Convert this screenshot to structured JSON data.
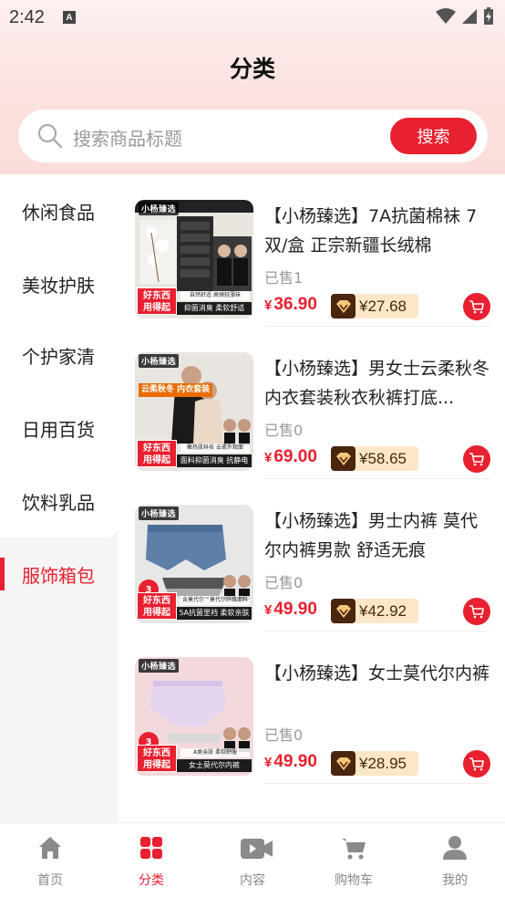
{
  "status_bar": {
    "time": "2:42"
  },
  "header": {
    "title": "分类"
  },
  "search": {
    "placeholder": "搜索商品标题",
    "button_label": "搜索"
  },
  "sidebar": {
    "items": [
      {
        "label": "休闲食品",
        "active": false
      },
      {
        "label": "美妆护肤",
        "active": false
      },
      {
        "label": "个护家清",
        "active": false
      },
      {
        "label": "日用百货",
        "active": false
      },
      {
        "label": "饮料乳品",
        "active": false
      },
      {
        "label": "服饰箱包",
        "active": true
      }
    ]
  },
  "products": [
    {
      "title": "【小杨臻选】7A抗菌棉袜 7双/盒 正宗新疆长绒棉",
      "sold": "已售1",
      "price_symbol": "¥",
      "price": "36.90",
      "vip_price": "¥27.68",
      "image": {
        "logo": "小杨臻选",
        "promo": "好东西 用得起",
        "tag": "抑菌消臭 柔软舒适",
        "subtag": "自然舒适 高弹轻薄袜"
      }
    },
    {
      "title": "【小杨臻选】男女士云柔秋冬内衣套装秋衣秋裤打底...",
      "sold": "已售0",
      "price_symbol": "¥",
      "price": "69.00",
      "vip_price": "¥58.65",
      "image": {
        "logo": "小杨臻选",
        "promo": "好东西 用得起",
        "tag": "面料抑菌消臭 抗静电",
        "subtag": "聚热肌科技 云柔外观面",
        "side": "云柔秋冬 内衣套装"
      }
    },
    {
      "title": "【小杨臻选】男士内裤 莫代尔内裤男款 舒适无痕",
      "sold": "已售0",
      "price_symbol": "¥",
      "price": "49.90",
      "vip_price": "¥42.92",
      "image": {
        "logo": "小杨臻选",
        "promo": "好东西 用得起",
        "tag": "5A抗菌里裆 柔软亲肤",
        "subtag": "含莫代尔™莫代尔纤维面料",
        "pack": "3"
      }
    },
    {
      "title": "【小杨臻选】女士莫代尔内裤",
      "sold": "已售0",
      "price_symbol": "¥",
      "price": "49.90",
      "vip_price": "¥28.95",
      "image": {
        "logo": "小杨臻选",
        "promo": "好东西 用得起",
        "tag": "女士莫代尔内裤",
        "subtag": "A类亲肤 柔软舒服",
        "pack": "3"
      }
    }
  ],
  "tabbar": {
    "items": [
      {
        "label": "首页",
        "icon": "home-icon",
        "active": false
      },
      {
        "label": "分类",
        "icon": "category-icon",
        "active": true
      },
      {
        "label": "内容",
        "icon": "video-icon",
        "active": false
      },
      {
        "label": "购物车",
        "icon": "cart-icon",
        "active": false
      },
      {
        "label": "我的",
        "icon": "user-icon",
        "active": false
      }
    ]
  },
  "colors": {
    "accent": "#e8202f",
    "vip_dark": "#4a2510",
    "vip_light": "#fbe7c8"
  }
}
